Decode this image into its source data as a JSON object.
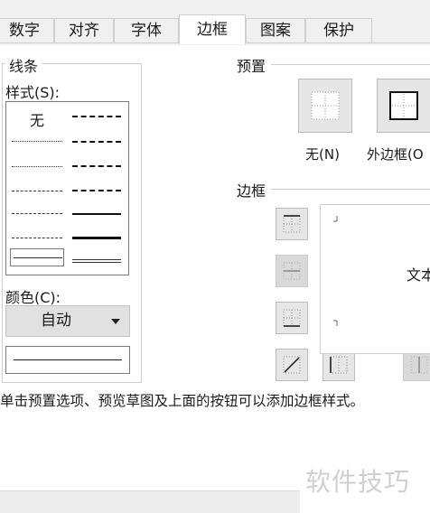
{
  "tabs": [
    {
      "label": "数字",
      "active": false
    },
    {
      "label": "对齐",
      "active": false
    },
    {
      "label": "字体",
      "active": false
    },
    {
      "label": "边框",
      "active": true
    },
    {
      "label": "图案",
      "active": false
    },
    {
      "label": "保护",
      "active": false
    }
  ],
  "line_group": {
    "title": "线条",
    "style_label": "样式(S):",
    "none_label": "无",
    "color_label": "颜色(C):",
    "color_value": "自动"
  },
  "presets": {
    "title": "预置",
    "none_label": "无(N)",
    "outline_label": "外边框(O"
  },
  "border": {
    "title": "边框",
    "preview_text": "文本"
  },
  "hint": "单击预置选项、预览草图及上面的按钮可以添加边框样式。",
  "watermark": "软件技巧",
  "colors": {
    "dialog_bg": "#ffffff",
    "tab_bar_bg": "#f0f0f0",
    "button_bg": "#e6e6e6",
    "frame": "#cfcfcf"
  }
}
